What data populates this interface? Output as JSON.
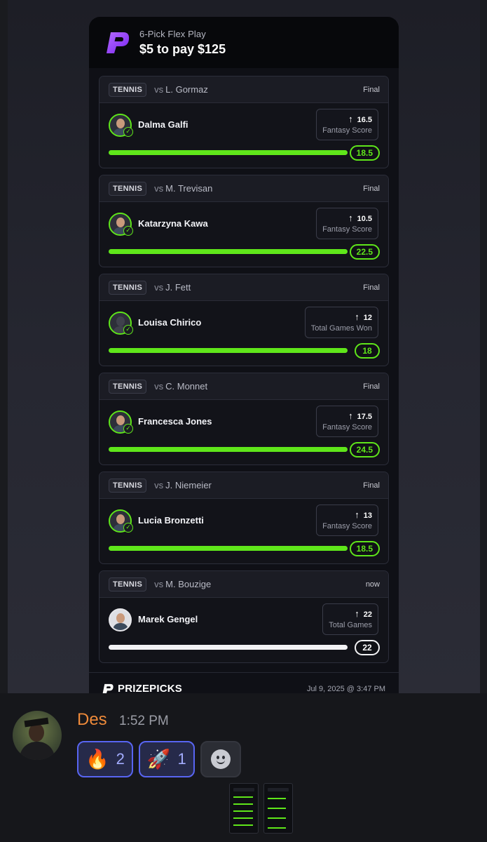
{
  "card": {
    "header_subtitle": "6-Pick Flex Play",
    "header_title": "$5 to pay $125",
    "footer_brand": "PRIZEPICKS",
    "footer_date": "Jul 9, 2025 @ 3:47 PM"
  },
  "picks": [
    {
      "sport": "TENNIS",
      "vs": "vs",
      "opponent": "L. Gormaz",
      "status": "Final",
      "player": "Dalma Galfi",
      "line": "16.5",
      "stat": "Fantasy Score",
      "result": "18.5",
      "progress": 1.0,
      "settled": true
    },
    {
      "sport": "TENNIS",
      "vs": "vs",
      "opponent": "M. Trevisan",
      "status": "Final",
      "player": "Katarzyna Kawa",
      "line": "10.5",
      "stat": "Fantasy Score",
      "result": "22.5",
      "progress": 1.0,
      "settled": true
    },
    {
      "sport": "TENNIS",
      "vs": "vs",
      "opponent": "J. Fett",
      "status": "Final",
      "player": "Louisa Chirico",
      "line": "12",
      "stat": "Total Games Won",
      "result": "18",
      "progress": 1.0,
      "settled": true
    },
    {
      "sport": "TENNIS",
      "vs": "vs",
      "opponent": "C. Monnet",
      "status": "Final",
      "player": "Francesca Jones",
      "line": "17.5",
      "stat": "Fantasy Score",
      "result": "24.5",
      "progress": 1.0,
      "settled": true
    },
    {
      "sport": "TENNIS",
      "vs": "vs",
      "opponent": "J. Niemeier",
      "status": "Final",
      "player": "Lucia Bronzetti",
      "line": "13",
      "stat": "Fantasy Score",
      "result": "18.5",
      "progress": 1.0,
      "settled": true
    },
    {
      "sport": "TENNIS",
      "vs": "vs",
      "opponent": "M. Bouzige",
      "status": "now",
      "player": "Marek Gengel",
      "line": "22",
      "stat": "Total Games",
      "result": "22",
      "progress": 1.0,
      "settled": false
    }
  ],
  "message": {
    "username": "Des",
    "time": "1:52 PM",
    "reactions": [
      {
        "emoji": "🔥",
        "count": "2"
      },
      {
        "emoji": "🚀",
        "count": "1"
      }
    ],
    "add_reaction_icon": "smiley-add-reaction-icon"
  },
  "colors": {
    "accent_green": "#5fe61a",
    "brand_purple": "#8f3cff",
    "username_orange": "#ee8a3a",
    "reaction_blue": "#5865f2"
  }
}
